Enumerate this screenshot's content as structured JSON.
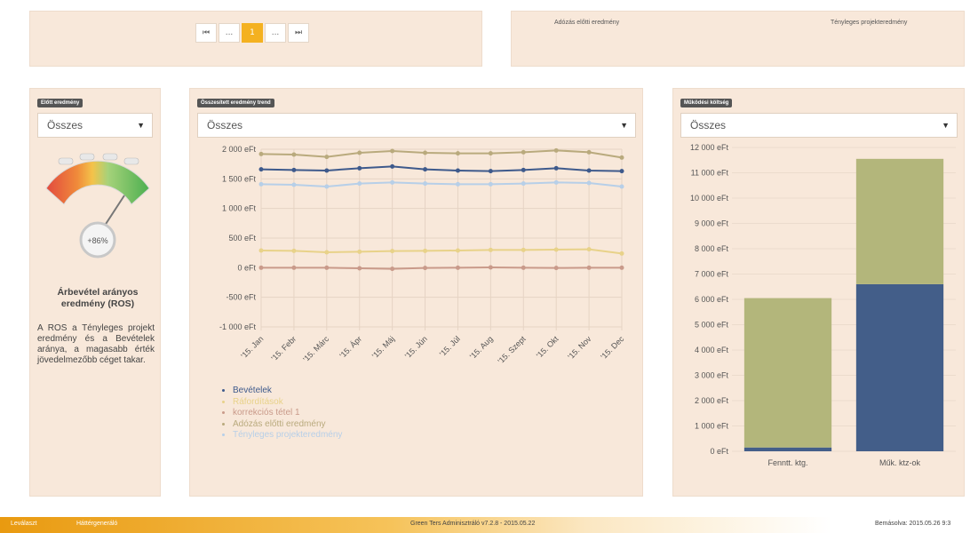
{
  "pager": {
    "first": "⏮",
    "ellipsis_left": "...",
    "current": "1",
    "ellipsis_right": "...",
    "last": "⏭"
  },
  "top_right_legend": {
    "left": "Adózás előtti eredmény",
    "right": "Tényleges projekteredmény"
  },
  "gauge_panel": {
    "tag": "Előtt eredmény",
    "select_value": "Összes",
    "gauge_value": "+86%",
    "title": "Árbevétel arányos eredmény (ROS)",
    "description": "A ROS a Tényleges projekt eredmény és a Bevételek aránya, a magasabb érték jövedelmezőbb céget takar."
  },
  "trend_panel": {
    "tag": "Összesített eredmény trend",
    "select_value": "Összes"
  },
  "cost_panel": {
    "tag": "Működési költség",
    "select_value": "Összes"
  },
  "colors": {
    "panel_bg": "#f8e8da",
    "bevetelek": "#3e5a8c",
    "raforditasok": "#e8d289",
    "korrekcio": "#c99a8a",
    "adozas_elotti": "#b9aa7d",
    "tenyleges": "#b7cfe8",
    "bar_green": "#b3b67b",
    "bar_blue": "#435e89",
    "active_page": "#f4b120"
  },
  "chart_data": [
    {
      "type": "line",
      "title": "",
      "categories": [
        "'15. Jan",
        "'15. Febr",
        "'15. Márc",
        "'15. Ápr",
        "'15. Máj",
        "'15. Jún",
        "'15. Júl",
        "'15. Aug",
        "'15. Szept",
        "'15. Okt",
        "'15. Nov",
        "'15. Dec"
      ],
      "y_tick_labels": [
        "2 000 eFt",
        "1 500 eFt",
        "1 000 eFt",
        "500 eFt",
        "0 eFt",
        "-500 eFt",
        "-1 000 eFt"
      ],
      "ylim": [
        -1000,
        2000
      ],
      "grid": true,
      "legend_position": "bottom",
      "series": [
        {
          "name": "Bevételek",
          "color": "#3e5a8c",
          "values": [
            1660,
            1650,
            1640,
            1680,
            1710,
            1660,
            1640,
            1630,
            1650,
            1680,
            1640,
            1630
          ]
        },
        {
          "name": "Ráfordítások",
          "color": "#e8d289",
          "values": [
            290,
            285,
            260,
            270,
            280,
            285,
            290,
            300,
            300,
            305,
            310,
            240
          ]
        },
        {
          "name": "korrekciós tétel 1",
          "color": "#c99a8a",
          "values": [
            0,
            0,
            0,
            -10,
            -20,
            -5,
            0,
            5,
            0,
            -5,
            0,
            0
          ]
        },
        {
          "name": "Adózás előtti eredmény",
          "color": "#b9aa7d",
          "values": [
            1920,
            1910,
            1870,
            1940,
            1970,
            1940,
            1930,
            1930,
            1950,
            1980,
            1950,
            1860
          ]
        },
        {
          "name": "Tényleges projekteredmény",
          "color": "#b7cfe8",
          "values": [
            1410,
            1400,
            1370,
            1420,
            1440,
            1420,
            1410,
            1410,
            1420,
            1440,
            1430,
            1370
          ]
        }
      ]
    },
    {
      "type": "bar",
      "categories": [
        "Fenntt. ktg.",
        "Műk. ktz-ok"
      ],
      "y_tick_labels": [
        "12 000 eFt",
        "11 000 eFt",
        "10 000 eFt",
        "9 000 eFt",
        "8 000 eFt",
        "7 000 eFt",
        "6 000 eFt",
        "5 000 eFt",
        "4 000 eFt",
        "3 000 eFt",
        "2 000 eFt",
        "1 000 eFt",
        "0 eFt"
      ],
      "ylim": [
        0,
        12000
      ],
      "stacked": true,
      "series": [
        {
          "color": "#435e89",
          "values": [
            150,
            6600
          ]
        },
        {
          "color": "#b3b67b",
          "values": [
            5900,
            4950
          ]
        }
      ]
    }
  ],
  "footer": {
    "left1": "Leválaszt",
    "left2": "Háttérgeneráló",
    "center": "Green Ters Adminisztráló v7.2.8 - 2015.05.22",
    "right": "Bemásolva: 2015.05.26 9:3"
  }
}
